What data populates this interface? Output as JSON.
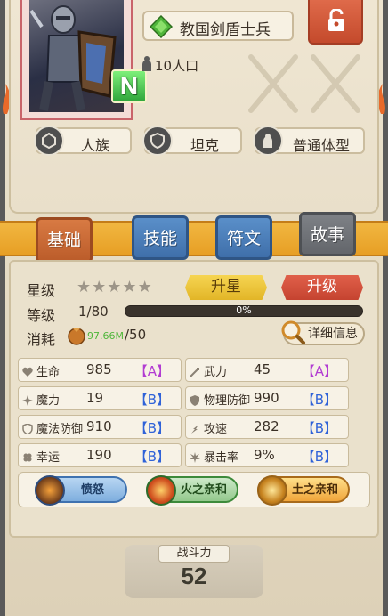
{
  "unit": {
    "name": "教国剑盾士兵",
    "rarity": "N",
    "population": "10人口",
    "tags": [
      {
        "icon": "race-icon",
        "label": "人族"
      },
      {
        "icon": "shield-icon",
        "label": "坦克"
      },
      {
        "icon": "body-icon",
        "label": "普通体型"
      }
    ]
  },
  "tabs": [
    {
      "label": "基础",
      "active": true
    },
    {
      "label": "技能"
    },
    {
      "label": "符文"
    },
    {
      "label": "故事"
    }
  ],
  "info": {
    "star_label": "星级",
    "stars_filled": 0,
    "stars_total": 5,
    "star_button": "升星",
    "upgrade_button": "升级",
    "level_label": "等级",
    "level_value": "1/80",
    "xp_percent_text": "0%",
    "xp_fraction": 0,
    "cost_label": "消耗",
    "cost_have": "97.66M",
    "cost_need": "/50",
    "detail_button": "详细信息"
  },
  "attributes": [
    {
      "icon": "hp-icon",
      "name": "生命",
      "value": "985",
      "grade": "【A】"
    },
    {
      "icon": "sword-icon",
      "name": "武力",
      "value": "45",
      "grade": "【A】"
    },
    {
      "icon": "magic-icon",
      "name": "魔力",
      "value": "19",
      "grade": "【B】"
    },
    {
      "icon": "armor-icon",
      "name": "物理防御",
      "value": "990",
      "grade": "【B】"
    },
    {
      "icon": "magic-shield-icon",
      "name": "魔法防御",
      "value": "910",
      "grade": "【B】"
    },
    {
      "icon": "speed-icon",
      "name": "攻速",
      "value": "282",
      "grade": "【B】"
    },
    {
      "icon": "luck-icon",
      "name": "幸运",
      "value": "190",
      "grade": "【B】"
    },
    {
      "icon": "crit-icon",
      "name": "暴击率",
      "value": "9%",
      "grade": "【B】"
    }
  ],
  "skills": [
    {
      "label": "愤怒"
    },
    {
      "label": "火之亲和"
    },
    {
      "label": "土之亲和"
    }
  ],
  "power": {
    "label": "战斗力",
    "value": "52"
  },
  "colors": {
    "grade_A": "#b23cd2",
    "grade_B": "#2f62d8",
    "tab_active": "#c9693a",
    "tab_blue": "#4a7dba",
    "tab_grey": "#6f7277",
    "star_button": "#efc63c",
    "upgrade_button": "#d24f3a"
  }
}
